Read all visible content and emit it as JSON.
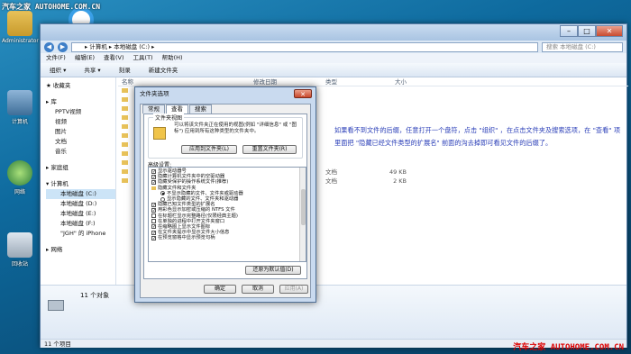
{
  "watermark_top": "汽车之家  AUTOHOME.COM.CN",
  "watermark_bottom": "汽车之家 AUTOHOME.COM.CN",
  "desktop": {
    "icons": [
      {
        "label": "Administrator"
      },
      {
        "label": "计算机"
      },
      {
        "label": "网络"
      },
      {
        "label": "回收站"
      }
    ]
  },
  "explorer": {
    "breadcrumb": "▸ 计算机 ▸ 本地磁盘 (C:) ▸",
    "search_placeholder": "搜索 本地磁盘 (C:)",
    "menu": [
      "文件(F)",
      "编辑(E)",
      "查看(V)",
      "工具(T)",
      "帮助(H)"
    ],
    "toolbar": [
      "组织 ▾",
      "共享 ▾",
      "刻录",
      "新建文件夹"
    ],
    "nav": [
      {
        "label": "收藏夹",
        "level": 0
      },
      {
        "label": "库",
        "level": 0,
        "gap": true
      },
      {
        "label": "PPTV视频",
        "level": 1
      },
      {
        "label": "视频",
        "level": 1
      },
      {
        "label": "图片",
        "level": 1
      },
      {
        "label": "文档",
        "level": 1
      },
      {
        "label": "音乐",
        "level": 1
      },
      {
        "label": "家庭组",
        "level": 0,
        "gap": true
      },
      {
        "label": "计算机",
        "level": 0,
        "gap": true
      },
      {
        "label": "本地磁盘 (C:)",
        "level": 2,
        "selected": true
      },
      {
        "label": "本地磁盘 (D:)",
        "level": 2
      },
      {
        "label": "本地磁盘 (E:)",
        "level": 2
      },
      {
        "label": "本地磁盘 (F:)",
        "level": 2
      },
      {
        "label": "\"JGH\" 的 iPhone",
        "level": 2
      },
      {
        "label": "网络",
        "level": 0,
        "gap": true
      }
    ],
    "columns": [
      "名称",
      "修改日期",
      "类型",
      "大小"
    ],
    "rows": [
      {
        "name": "",
        "date": "",
        "type": "",
        "size": ""
      },
      {
        "name": "",
        "date": "",
        "type": "",
        "size": ""
      },
      {
        "name": "",
        "date": "",
        "type": "",
        "size": ""
      },
      {
        "name": "",
        "date": "",
        "type": "",
        "size": ""
      },
      {
        "name": "",
        "date": "",
        "type": "",
        "size": ""
      },
      {
        "name": "",
        "date": "",
        "type": "",
        "size": ""
      },
      {
        "name": "",
        "date": "",
        "type": "",
        "size": ""
      },
      {
        "name": "",
        "date": "",
        "type": "",
        "size": ""
      },
      {
        "name": "",
        "date": "",
        "type": "",
        "size": ""
      },
      {
        "name": "",
        "date": "",
        "type": "文档",
        "size": "49 KB"
      },
      {
        "name": "",
        "date": "",
        "type": "文档",
        "size": "2 KB"
      }
    ],
    "annotation": "如果看不到文件的后缀，任意打开一个盘符，点击 \"组织\" ，在点击文件夹及搜索选项，在 \"查看\" 项里面把 \"隐藏已经文件类型的扩展名\" 前面的沟去掉即可看见文件的后缀了。",
    "details_count": "11 个对象",
    "status": "11 个项目"
  },
  "dialog": {
    "title": "文件夹选项",
    "tabs": [
      "常规",
      "查看",
      "搜索"
    ],
    "folder_view_title": "文件夹视图",
    "folder_view_text": "可以将该文件夹正在使用的视图(例如 \"详细信息\" 或 \"图标\") 应用到所有这种类型的文件夹中。",
    "apply_button": "应用到文件夹(L)",
    "reset_button": "重置文件夹(R)",
    "advanced_label": "高级设置:",
    "options": [
      {
        "text": "显示驱动器号",
        "kind": "check",
        "checked": true
      },
      {
        "text": "隐藏计算机文件夹中的空驱动器",
        "kind": "check",
        "checked": true
      },
      {
        "text": "隐藏受保护的操作系统文件(推荐)",
        "kind": "check",
        "checked": true
      },
      {
        "text": "隐藏文件和文件夹",
        "kind": "folder"
      },
      {
        "text": "不显示隐藏的文件、文件夹或驱动器",
        "kind": "radio",
        "checked": true
      },
      {
        "text": "显示隐藏的文件、文件夹和驱动器",
        "kind": "radio",
        "checked": false
      },
      {
        "text": "隐藏已知文件类型的扩展名",
        "kind": "check",
        "checked": true
      },
      {
        "text": "用彩色显示加密或压缩的 NTFS 文件",
        "kind": "check",
        "checked": true
      },
      {
        "text": "在标题栏显示完整路径(仅限经典主题)",
        "kind": "check",
        "checked": false
      },
      {
        "text": "在单独的进程中打开文件夹窗口",
        "kind": "check",
        "checked": false
      },
      {
        "text": "在缩略图上显示文件图标",
        "kind": "check",
        "checked": true
      },
      {
        "text": "在文件夹提示中显示文件大小信息",
        "kind": "check",
        "checked": true
      },
      {
        "text": "在预览窗格中显示预览句柄",
        "kind": "check",
        "checked": true
      }
    ],
    "restore_button": "还原为默认值(D)",
    "ok": "确定",
    "cancel": "取消",
    "apply": "应用(A)"
  }
}
